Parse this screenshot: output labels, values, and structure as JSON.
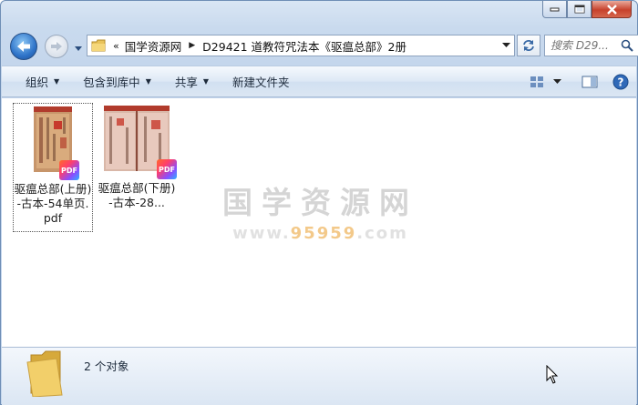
{
  "window": {
    "caption_buttons": [
      "minimize",
      "maximize",
      "close"
    ]
  },
  "address_bar": {
    "breadcrumbs": [
      "国学资源网",
      "D29421 道教符咒法本《驱瘟总部》2册"
    ],
    "overflow_chevron": "«"
  },
  "search": {
    "placeholder": "搜索 D29..."
  },
  "toolbar": {
    "organize": "组织",
    "include_in_library": "包含到库中",
    "share": "共享",
    "new_folder": "新建文件夹"
  },
  "files": [
    {
      "label": "驱瘟总部(上册)-古本-54单页.pdf",
      "badge": "PDF",
      "selected": true
    },
    {
      "label": "驱瘟总部(下册)-古本-28...",
      "badge": "PDF",
      "selected": false
    }
  ],
  "watermark": {
    "title": "国学资源网",
    "url_part1": "www.",
    "url_part2": "95959",
    "url_part3": ".com"
  },
  "status": {
    "item_count": "2 个对象"
  },
  "colors": {
    "frame": "#c4d6ec",
    "toolbar": "#dbe6f3",
    "close_button": "#c7412c",
    "pdf_badge": "#ff3f6b"
  }
}
